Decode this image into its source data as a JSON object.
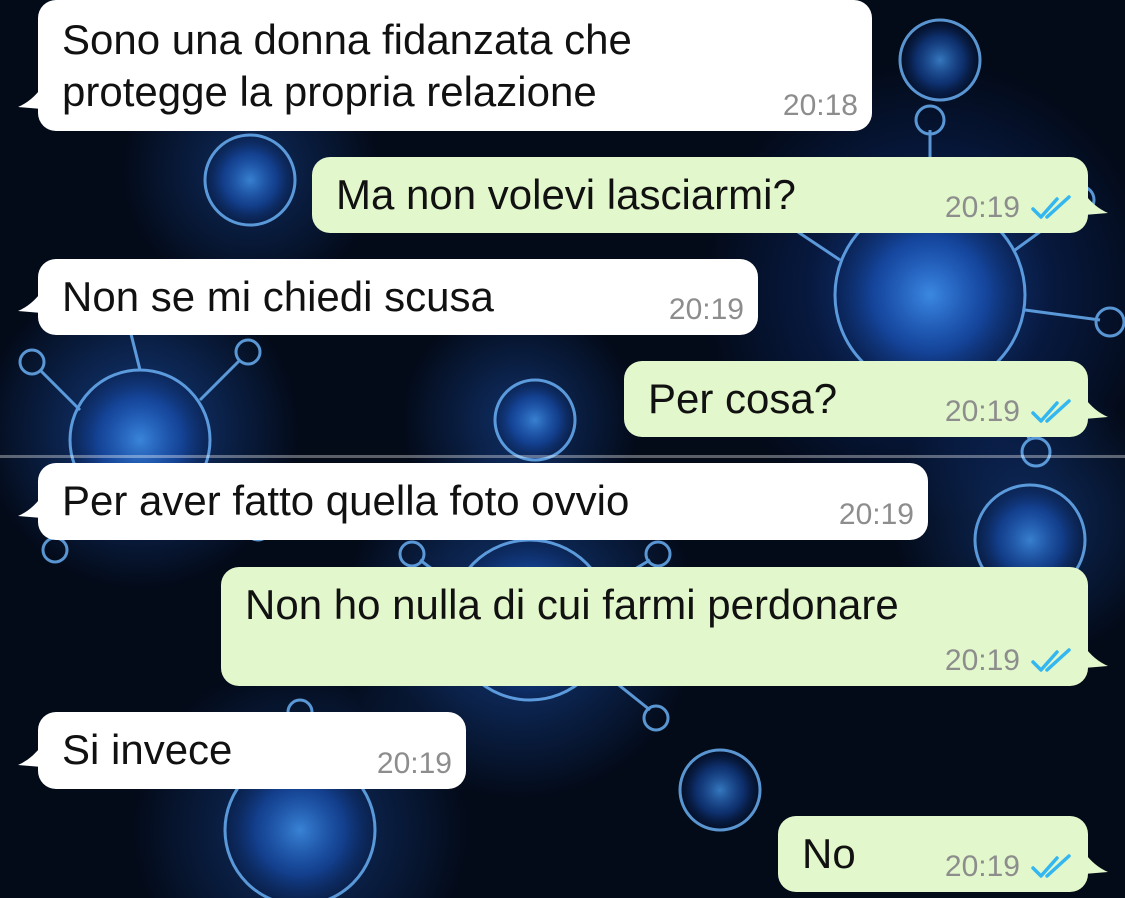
{
  "colors": {
    "incoming_bubble": "#ffffff",
    "outgoing_bubble": "#e2f7cb",
    "timestamp": "#8d8d8d",
    "read_ticks": "#34b7f1"
  },
  "messages": [
    {
      "direction": "incoming",
      "text_line1": "Sono una donna fidanzata che",
      "text_line2": "protegge la propria relazione",
      "time": "20:18"
    },
    {
      "direction": "outgoing",
      "text": "Ma non volevi lasciarmi?",
      "time": "20:19",
      "status_icon": "double-check-read-icon"
    },
    {
      "direction": "incoming",
      "text": "Non se mi chiedi scusa",
      "time": "20:19"
    },
    {
      "direction": "outgoing",
      "text": "Per cosa?",
      "time": "20:19",
      "status_icon": "double-check-read-icon"
    },
    {
      "direction": "incoming",
      "text": "Per aver fatto quella foto ovvio",
      "time": "20:19"
    },
    {
      "direction": "outgoing",
      "text": "Non ho nulla di cui farmi perdonare",
      "time": "20:19",
      "status_icon": "double-check-read-icon"
    },
    {
      "direction": "incoming",
      "text": "Si invece",
      "time": "20:19"
    },
    {
      "direction": "outgoing",
      "text": "No",
      "time": "20:19",
      "status_icon": "double-check-read-icon"
    }
  ]
}
